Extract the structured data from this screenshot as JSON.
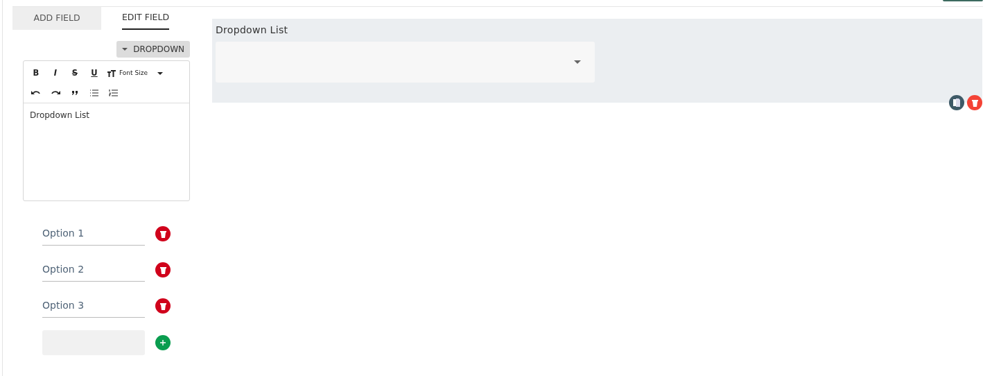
{
  "tabs": [
    {
      "label": "ADD FIELD",
      "selected": false
    },
    {
      "label": "EDIT FIELD",
      "selected": true
    }
  ],
  "type_button": {
    "label": "DROPDOWN"
  },
  "editor": {
    "toolbar": [
      [
        {
          "kind": "bold",
          "label": "B"
        },
        {
          "kind": "italic",
          "label": "I"
        },
        {
          "kind": "strike",
          "label": "S"
        },
        {
          "kind": "underline",
          "label": "U"
        },
        {
          "kind": "fontsize",
          "label": "Font Size"
        }
      ],
      [
        {
          "kind": "undo"
        },
        {
          "kind": "redo"
        },
        {
          "kind": "quote"
        },
        {
          "kind": "bullets"
        },
        {
          "kind": "numbers"
        }
      ]
    ],
    "content": "Dropdown List"
  },
  "options": [
    {
      "value": "Option 1"
    },
    {
      "value": "Option 2"
    },
    {
      "value": "Option 3"
    }
  ],
  "preview": {
    "label": "Dropdown List"
  }
}
